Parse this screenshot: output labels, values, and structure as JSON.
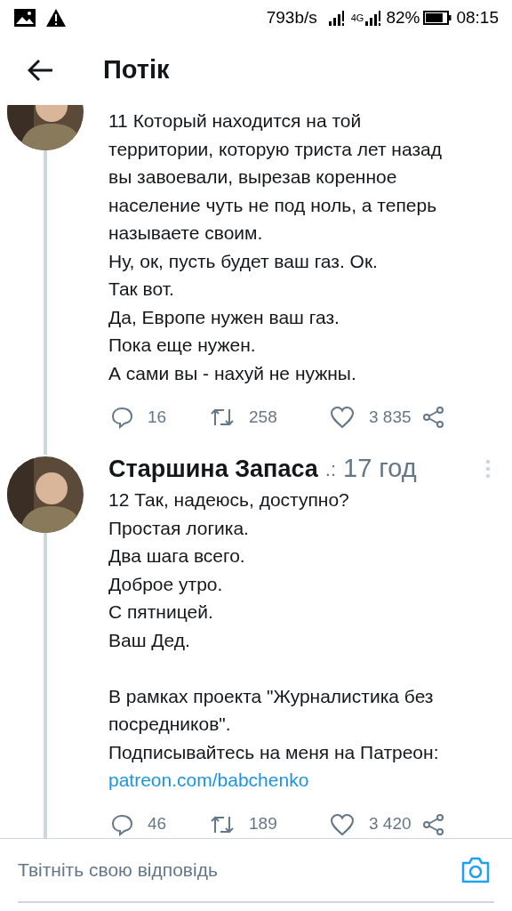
{
  "status_bar": {
    "speed": "793b/s",
    "network": "4G",
    "battery": "82%",
    "time": "08:15"
  },
  "header": {
    "title": "Потік"
  },
  "tweets": [
    {
      "text": "11 Который находится на той\nтерритории, которую триста лет назад\nвы завоевали, вырезав коренное\nнаселение чуть не под ноль, а теперь\nназываете своим.\nНу, ок, пусть будет ваш газ. Ок.\nТак вот.\nДа, Европе нужен ваш газ.\nПока еще нужен.\nА сами вы - нахуй не нужны.",
      "replies": "16",
      "retweets": "258",
      "likes": "3 835"
    },
    {
      "author": "Старшина Запаса",
      "handle": ".:",
      "time": "17 год",
      "text": "12 Так, надеюсь, доступно?\nПростая логика.\nДва шага всего.\nДоброе утро.\nС пятницей.\nВаш Дед.\n\nВ рамках проекта \"Журналистика без посредников\".\nПодписывайтесь на меня на Патреон:",
      "link": "patreon.com/babchenko",
      "replies": "46",
      "retweets": "189",
      "likes": "3 420"
    }
  ],
  "reply_field": {
    "placeholder": "Твітніть свою відповідь"
  }
}
